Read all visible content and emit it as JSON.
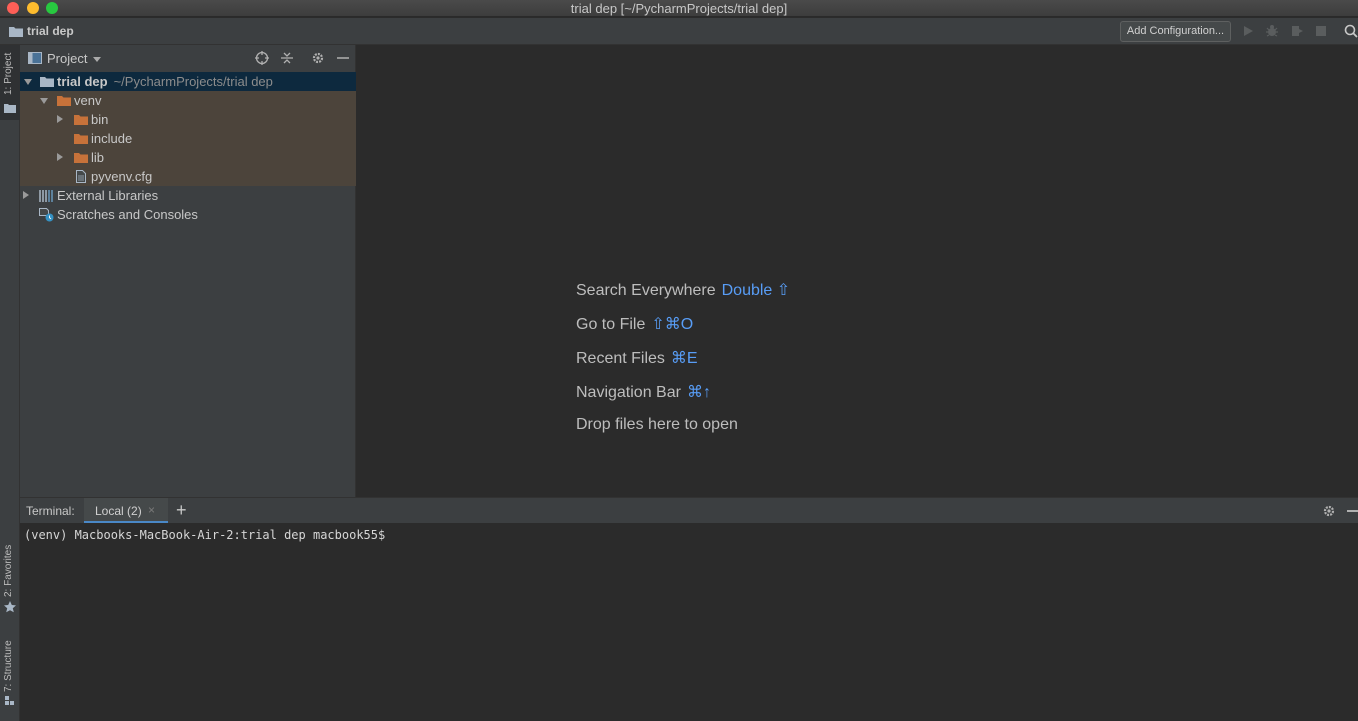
{
  "window": {
    "title": "trial dep [~/PycharmProjects/trial dep]"
  },
  "navbar": {
    "project_name": "trial dep",
    "add_configuration": "Add Configuration..."
  },
  "stripe": {
    "project_tab": "1: Project",
    "favorites_tab": "2: Favorites",
    "structure_tab": "7: Structure"
  },
  "project_panel": {
    "title": "Project",
    "tree": {
      "root": {
        "name": "trial dep",
        "path": "~/PycharmProjects/trial dep"
      },
      "venv": "venv",
      "bin": "bin",
      "include": "include",
      "lib": "lib",
      "cfg": "pyvenv.cfg",
      "external": "External Libraries",
      "scratches": "Scratches and Consoles"
    }
  },
  "editor": {
    "hints": [
      {
        "label": "Search Everywhere",
        "shortcut": "Double ⇧"
      },
      {
        "label": "Go to File",
        "shortcut": "⇧⌘O"
      },
      {
        "label": "Recent Files",
        "shortcut": "⌘E"
      },
      {
        "label": "Navigation Bar",
        "shortcut": "⌘↑"
      },
      {
        "label": "Drop files here to open",
        "shortcut": ""
      }
    ]
  },
  "terminal": {
    "label": "Terminal:",
    "tab": "Local (2)",
    "tab_close": "×",
    "add": "+",
    "prompt": "(venv) Macbooks-MacBook-Air-2:trial dep macbook55$"
  },
  "colors": {
    "accent": "#589df6",
    "folder": "#c7723a",
    "selection": "#0d293e"
  }
}
